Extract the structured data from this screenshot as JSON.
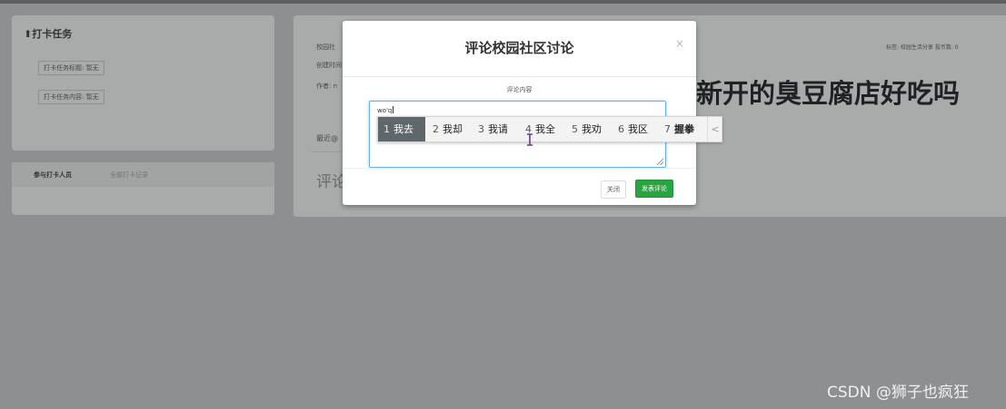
{
  "sidebar": {
    "checkin_title": "⬆打卡任务",
    "task_title_chip": "打卡任务标题: 暂无",
    "task_content_chip": "打卡任务内容: 暂无",
    "tabs": [
      {
        "label": "参与打卡人员"
      },
      {
        "label": "全部打卡记录"
      }
    ]
  },
  "post": {
    "meta_category": "校园社",
    "meta_created": "创建时间",
    "meta_author": "作者: n",
    "tags_text": "标签: 校园生活分享 投币数: 0",
    "title": "新开的臭豆腐店好吃吗",
    "recent_label": "最近@",
    "comments_heading": "评论"
  },
  "modal": {
    "title": "评论校园社区讨论",
    "close_glyph": "×",
    "field_label": "评论内容",
    "textarea_value": "wo'q",
    "close_button": "关闭",
    "submit_button": "发表评论"
  },
  "ime": {
    "candidates": [
      {
        "num": "1",
        "text": "我去"
      },
      {
        "num": "2",
        "text": "我却"
      },
      {
        "num": "3",
        "text": "我请"
      },
      {
        "num": "4",
        "text": "我全"
      },
      {
        "num": "5",
        "text": "我劝"
      },
      {
        "num": "6",
        "text": "我区"
      },
      {
        "num": "7",
        "text": "握拳"
      }
    ],
    "prev_glyph": "<",
    "selected_index": 0
  },
  "watermark": "CSDN @狮子也疯狂",
  "colors": {
    "overlay": "#8d8f90",
    "submit_green": "#2aa43f",
    "textarea_focus": "#66afe9",
    "ime_selected": "#5e6769"
  }
}
